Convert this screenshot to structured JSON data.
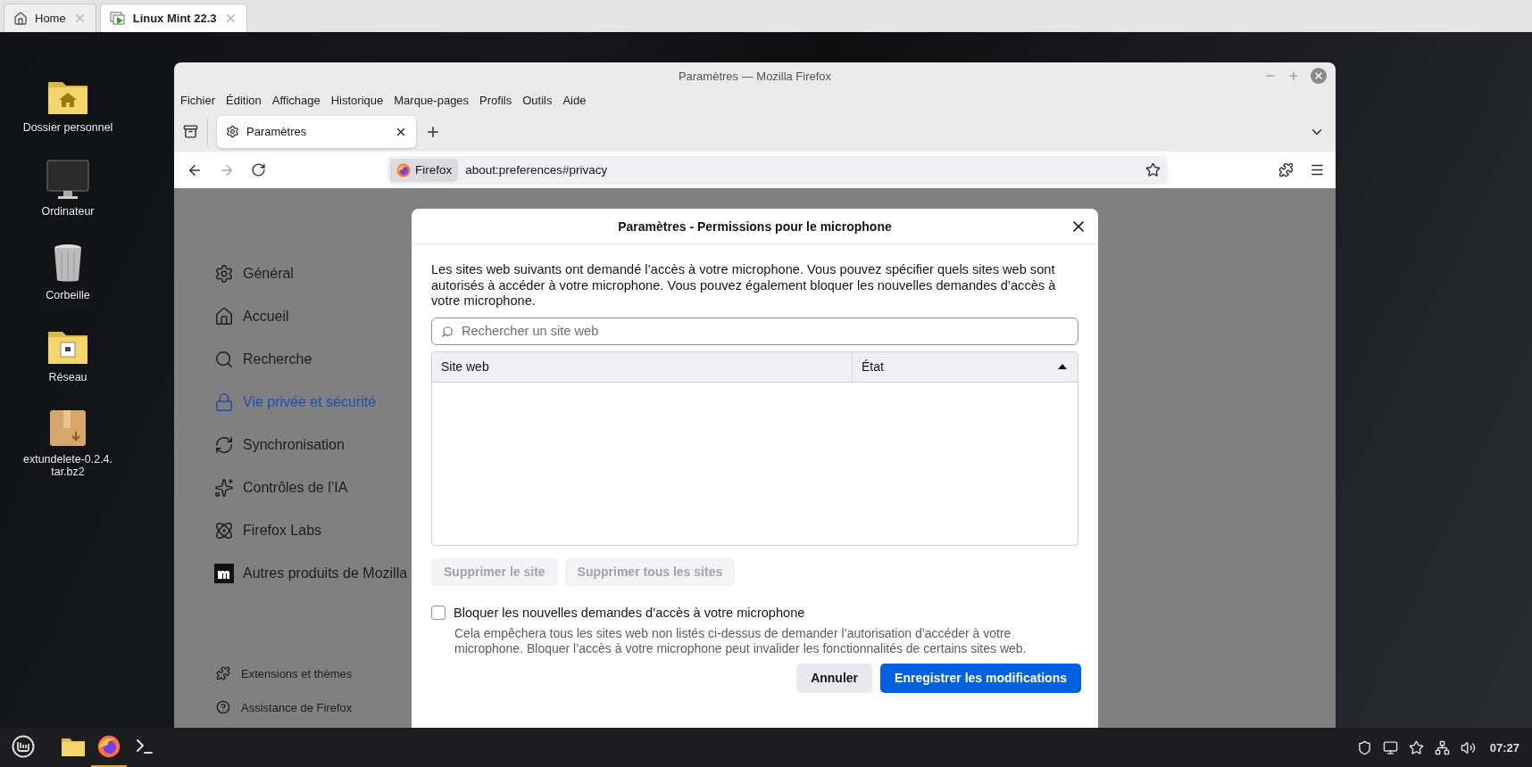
{
  "host_tabs": [
    {
      "label": "Home",
      "selected": false
    },
    {
      "label": "Linux Mint 22.3",
      "selected": true
    }
  ],
  "desktop_icons": [
    {
      "label": "Dossier personnel"
    },
    {
      "label": "Ordinateur"
    },
    {
      "label": "Corbeille"
    },
    {
      "label": "Réseau"
    },
    {
      "label": "extundelete-0.2.4.\ntar.bz2"
    }
  ],
  "window": {
    "title": "Paramètres — Mozilla Firefox",
    "menu": [
      "Fichier",
      "Édition",
      "Affichage",
      "Historique",
      "Marque-pages",
      "Profils",
      "Outils",
      "Aide"
    ],
    "tabs": [
      {
        "label": "Paramètres",
        "selected": true
      }
    ],
    "identity": "Firefox",
    "url": "about:preferences#privacy"
  },
  "sidebar": {
    "items": [
      {
        "label": "Général",
        "selected": false
      },
      {
        "label": "Accueil",
        "selected": false
      },
      {
        "label": "Recherche",
        "selected": false
      },
      {
        "label": "Vie privée et sécurité",
        "selected": true
      },
      {
        "label": "Synchronisation",
        "selected": false
      },
      {
        "label": "Contrôles de l’IA",
        "selected": false
      },
      {
        "label": "Firefox Labs",
        "selected": false
      },
      {
        "label": "Autres produits de Mozilla",
        "selected": false
      }
    ],
    "footer": [
      "Extensions et thèmes",
      "Assistance de Firefox"
    ]
  },
  "dialog": {
    "title": "Paramètres - Permissions pour le microphone",
    "description": "Les sites web suivants ont demandé l’accès à votre microphone. Vous pouvez spécifier quels sites web sont autorisés à accéder à votre microphone. Vous pouvez également bloquer les nouvelles demandes d’accès à votre microphone.",
    "search": {
      "placeholder": "Rechercher un site web"
    },
    "table": {
      "columns": [
        {
          "label": "Site web",
          "sorted": false
        },
        {
          "label": "État",
          "sorted": true
        }
      ]
    },
    "actions": [
      {
        "label": "Supprimer le site",
        "disabled": true
      },
      {
        "label": "Supprimer tous les sites",
        "disabled": true
      }
    ],
    "block": {
      "label": "Bloquer les nouvelles demandes d’accès à votre microphone",
      "checked": false,
      "help": "Cela empêchera tous les sites web non listés ci-dessus de demander l’autorisation d’accéder à votre microphone. Bloquer l’accès à votre microphone peut invalider les fonctionnalités de certains sites web."
    },
    "buttons": [
      {
        "label": "Annuler",
        "primary": false
      },
      {
        "label": "Enregistrer les modifications",
        "primary": true
      }
    ]
  },
  "taskbar": {
    "clock": "07:27"
  }
}
